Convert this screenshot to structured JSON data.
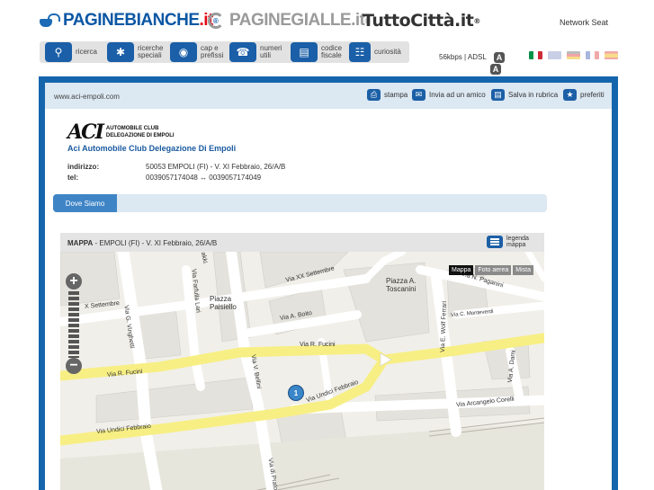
{
  "brands": {
    "paginebianche": {
      "name": "PAGINEBIANCHE",
      "suffix": ".it",
      "mark": "®"
    },
    "paginegialle": {
      "name": "PAGINEGIALLE.it",
      "mark": "®"
    },
    "tuttocitta": {
      "name": "TuttoCittà.it",
      "mark": "®"
    },
    "network": "Network Seat"
  },
  "nav": {
    "items": [
      {
        "label": "ricerca",
        "icon": "search-icon"
      },
      {
        "label": "ricerche\nspeciali",
        "icon": "puzzle-icon"
      },
      {
        "label": "cap e\nprefissi",
        "icon": "globe-icon"
      },
      {
        "label": "numeri\nutili",
        "icon": "phone-icon"
      },
      {
        "label": "codice\nfiscale",
        "icon": "card-icon"
      },
      {
        "label": "curiosità",
        "icon": "book-icon"
      }
    ],
    "speed": "56kbps | ADSL",
    "text_size_label": "A",
    "text_size_label_2": "A",
    "flags": [
      "Italiano",
      "English",
      "Deutsch",
      "Français",
      "Español"
    ]
  },
  "card": {
    "url": "www.aci-empoli.com",
    "actions": [
      {
        "label": "stampa",
        "icon": "print-icon"
      },
      {
        "label": "Invia ad un amico",
        "icon": "mail-icon"
      },
      {
        "label": "Salva in rubrica",
        "icon": "folder-icon"
      },
      {
        "label": "preferiti",
        "icon": "star-icon"
      }
    ],
    "logo_mark": "ACI",
    "logo_text": "AUTOMOBILE CLUB\nDELEGAZIONE DI EMPOLI",
    "company": "Aci Automobile Club Delegazione Di Empoli",
    "address_label": "indirizzo:",
    "address": "50053 EMPOLI (FI) - V. XI Febbraio, 26/A/B",
    "phone_label": "tel:",
    "phones": "0039057174048 ↔ 0039057174049",
    "tab": "Dove Siamo"
  },
  "map": {
    "title_bold": "MAPPA",
    "title": "EMPOLI (FI) - V. XI Febbraio, 26/A/B",
    "legend_label": "legenda\nmappa",
    "types": [
      "Mappa",
      "Foto aerea",
      "Mista"
    ],
    "zoom_in": "+",
    "zoom_out": "−",
    "pin_label": "1",
    "streets": {
      "xx_settembre": "Via XX Settembre",
      "x_settembre": "X Settembre",
      "fucini_top": "Via R. Fucini",
      "fucini_left": "Via R. Fucini",
      "boito": "Via A. Boito",
      "undici_right": "Via Undici Febbraio",
      "undici_left": "Via Undici Febbraio",
      "arcangelo": "Via Arcangelo Corelli",
      "paganini": "Via N. Paganini",
      "monteverdi": "Via C. Monteverdi",
      "wolf": "Via E. Wolf Ferrari",
      "vinghetti": "Via G. Vinghetti",
      "farfulla": "Via Farfulla Lari",
      "bellini": "Via V. Bellini",
      "dami": "Via A. Dami",
      "prato": "Via di Prato",
      "piazza_toscanini": "Piazza A.\nToscanini",
      "piazza_paisiello": "Piazza\nPaisiello",
      "top_fragment": "rakki"
    }
  }
}
